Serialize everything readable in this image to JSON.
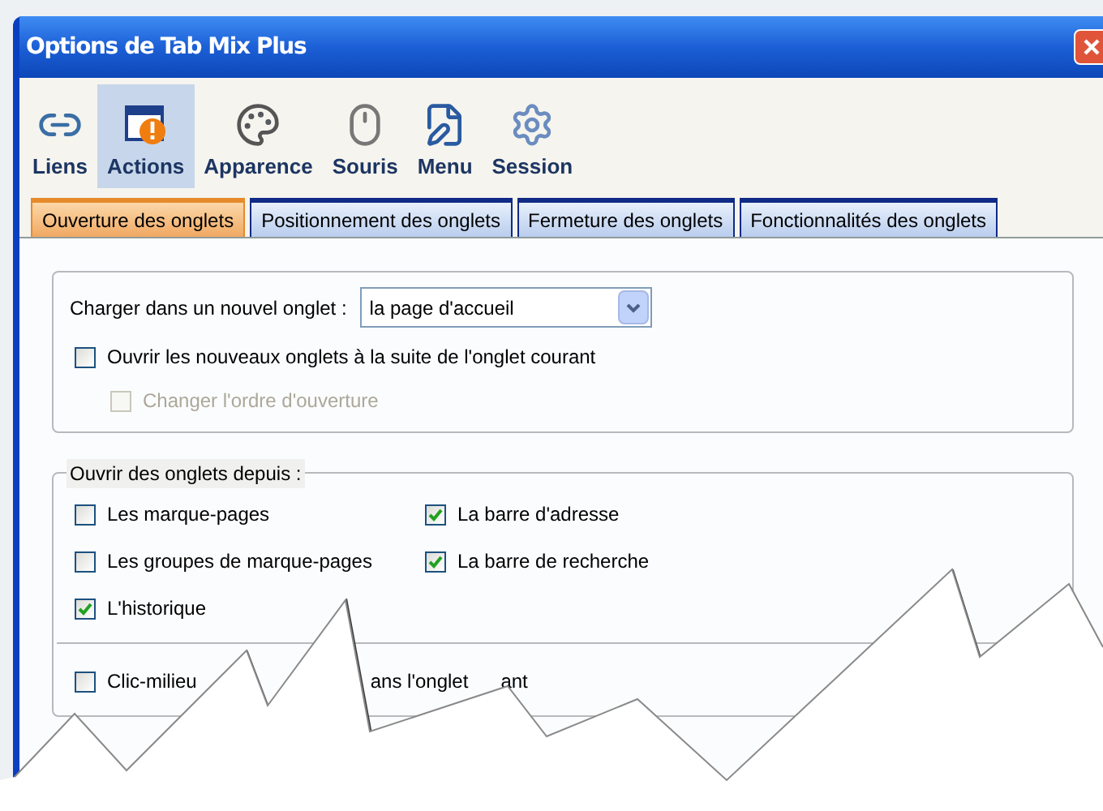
{
  "window": {
    "title": "Options de Tab Mix Plus"
  },
  "toolbar": [
    {
      "label": "Liens",
      "kind": "links",
      "selected": false
    },
    {
      "label": "Actions",
      "kind": "actions",
      "selected": true
    },
    {
      "label": "Apparence",
      "kind": "appearance",
      "selected": false
    },
    {
      "label": "Souris",
      "kind": "mouse",
      "selected": false
    },
    {
      "label": "Menu",
      "kind": "menu",
      "selected": false
    },
    {
      "label": "Session",
      "kind": "session",
      "selected": false
    }
  ],
  "tabs": [
    {
      "label": "Ouverture des onglets",
      "selected": true
    },
    {
      "label": "Positionnement des onglets",
      "selected": false
    },
    {
      "label": "Fermeture des onglets",
      "selected": false
    },
    {
      "label": "Fonctionnalités des onglets",
      "selected": false
    }
  ],
  "load_group": {
    "label": "Charger dans un nouvel onglet :",
    "dropdown": {
      "value": "la page d'accueil"
    },
    "checkboxes": [
      {
        "label": "Ouvrir les nouveaux onglets à la suite de l'onglet courant",
        "checked": false,
        "disabled": false,
        "indented": false
      },
      {
        "label": "Changer l'ordre d'ouverture",
        "checked": false,
        "disabled": true,
        "indented": true
      }
    ]
  },
  "open_from_group": {
    "title": "Ouvrir des onglets depuis :",
    "checkboxes": [
      {
        "label": "Les marque-pages",
        "checked": false
      },
      {
        "label": "La barre d'adresse",
        "checked": true
      },
      {
        "label": "Les groupes de marque-pages",
        "checked": false
      },
      {
        "label": "La barre de recherche",
        "checked": true
      },
      {
        "label": "L'historique",
        "checked": true
      }
    ],
    "middle_click": {
      "checked": false,
      "fragments": [
        "Clic-milieu",
        "ans l'onglet",
        "ant"
      ]
    }
  }
}
